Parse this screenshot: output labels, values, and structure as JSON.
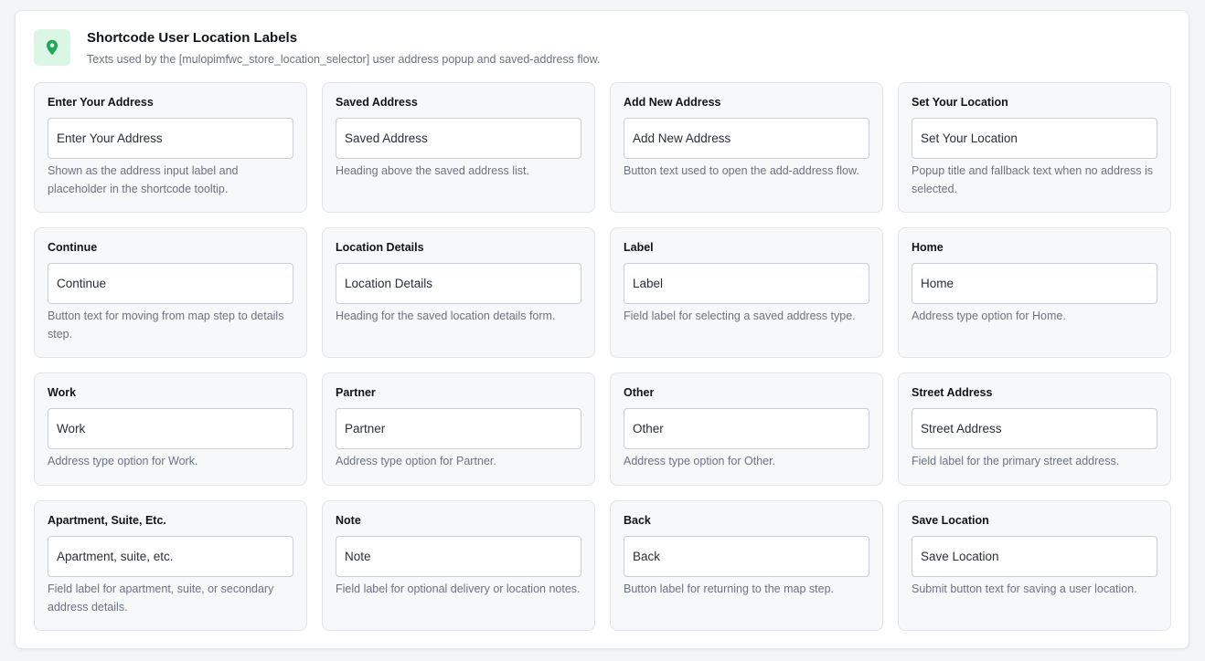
{
  "header": {
    "title": "Shortcode User Location Labels",
    "description": "Texts used by the [mulopimfwc_store_location_selector] user address popup and saved-address flow.",
    "icon": "map-pin-icon",
    "accent_color": "#1fa855",
    "icon_bg": "#dcf6e6"
  },
  "fields": [
    {
      "id": "enter-your-address",
      "label": "Enter Your Address",
      "value": "Enter Your Address",
      "help": "Shown as the address input label and placeholder in the shortcode tooltip."
    },
    {
      "id": "saved-address",
      "label": "Saved Address",
      "value": "Saved Address",
      "help": "Heading above the saved address list."
    },
    {
      "id": "add-new-address",
      "label": "Add New Address",
      "value": "Add New Address",
      "help": "Button text used to open the add-address flow."
    },
    {
      "id": "set-your-location",
      "label": "Set Your Location",
      "value": "Set Your Location",
      "help": "Popup title and fallback text when no address is selected."
    },
    {
      "id": "continue",
      "label": "Continue",
      "value": "Continue",
      "help": "Button text for moving from map step to details step."
    },
    {
      "id": "location-details",
      "label": "Location Details",
      "value": "Location Details",
      "help": "Heading for the saved location details form."
    },
    {
      "id": "label",
      "label": "Label",
      "value": "Label",
      "help": "Field label for selecting a saved address type."
    },
    {
      "id": "home",
      "label": "Home",
      "value": "Home",
      "help": "Address type option for Home."
    },
    {
      "id": "work",
      "label": "Work",
      "value": "Work",
      "help": "Address type option for Work."
    },
    {
      "id": "partner",
      "label": "Partner",
      "value": "Partner",
      "help": "Address type option for Partner."
    },
    {
      "id": "other",
      "label": "Other",
      "value": "Other",
      "help": "Address type option for Other."
    },
    {
      "id": "street-address",
      "label": "Street Address",
      "value": "Street Address",
      "help": "Field label for the primary street address."
    },
    {
      "id": "apartment-suite-etc",
      "label": "Apartment, Suite, Etc.",
      "value": "Apartment, suite, etc.",
      "help": "Field label for apartment, suite, or secondary address details."
    },
    {
      "id": "note",
      "label": "Note",
      "value": "Note",
      "help": "Field label for optional delivery or location notes."
    },
    {
      "id": "back",
      "label": "Back",
      "value": "Back",
      "help": "Button label for returning to the map step."
    },
    {
      "id": "save-location",
      "label": "Save Location",
      "value": "Save Location",
      "help": "Submit button text for saving a user location."
    }
  ]
}
